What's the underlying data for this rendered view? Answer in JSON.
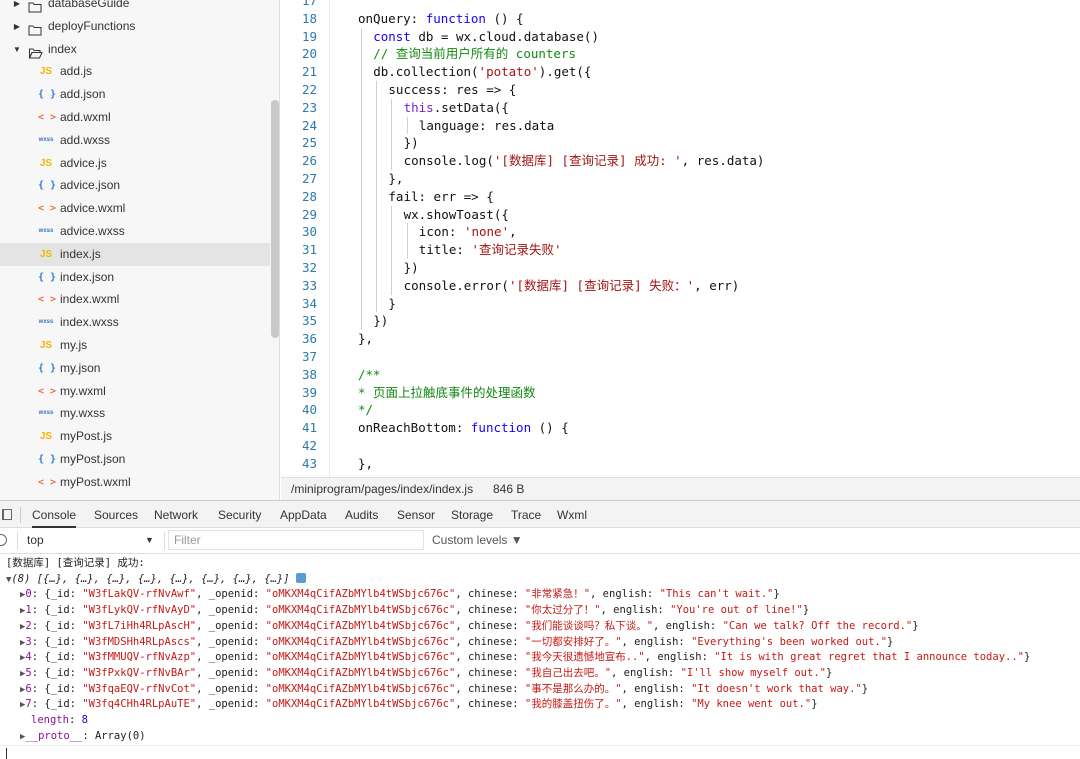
{
  "file_tree": {
    "items": [
      {
        "type": "folder",
        "name": "databaseGuide",
        "expanded": false
      },
      {
        "type": "folder",
        "name": "deployFunctions",
        "expanded": false
      },
      {
        "type": "folder",
        "name": "index",
        "expanded": true
      },
      {
        "type": "js",
        "name": "add.js"
      },
      {
        "type": "json",
        "name": "add.json"
      },
      {
        "type": "wxml",
        "name": "add.wxml"
      },
      {
        "type": "wxss",
        "name": "add.wxss"
      },
      {
        "type": "js",
        "name": "advice.js"
      },
      {
        "type": "json",
        "name": "advice.json"
      },
      {
        "type": "wxml",
        "name": "advice.wxml"
      },
      {
        "type": "wxss",
        "name": "advice.wxss"
      },
      {
        "type": "js",
        "name": "index.js",
        "selected": true
      },
      {
        "type": "json",
        "name": "index.json"
      },
      {
        "type": "wxml",
        "name": "index.wxml"
      },
      {
        "type": "wxss",
        "name": "index.wxss"
      },
      {
        "type": "js",
        "name": "my.js"
      },
      {
        "type": "json",
        "name": "my.json"
      },
      {
        "type": "wxml",
        "name": "my.wxml"
      },
      {
        "type": "wxss",
        "name": "my.wxss"
      },
      {
        "type": "js",
        "name": "myPost.js"
      },
      {
        "type": "json",
        "name": "myPost.json"
      },
      {
        "type": "wxml",
        "name": "myPost.wxml"
      }
    ],
    "icon_glyphs": {
      "js": "JS",
      "json": "{ }",
      "wxml": "< >",
      "wxss": "wxss"
    }
  },
  "editor": {
    "lines": [
      {
        "n": "17",
        "indent": 0,
        "tokens": []
      },
      {
        "n": "18",
        "indent": 0,
        "tokens": [
          [
            "p",
            "onQuery: "
          ],
          [
            "k",
            "function"
          ],
          [
            "p",
            " () {"
          ]
        ]
      },
      {
        "n": "19",
        "indent": 1,
        "tokens": [
          [
            "k",
            "const"
          ],
          [
            "p",
            " db = wx.cloud.database()"
          ]
        ]
      },
      {
        "n": "20",
        "indent": 1,
        "tokens": [
          [
            "c",
            "// 查询当前用户所有的 counters"
          ]
        ]
      },
      {
        "n": "21",
        "indent": 1,
        "tokens": [
          [
            "p",
            "db.collection("
          ],
          [
            "s",
            "'potato'"
          ],
          [
            "p",
            ").get({"
          ]
        ]
      },
      {
        "n": "22",
        "indent": 2,
        "tokens": [
          [
            "p",
            "success: res => {"
          ]
        ]
      },
      {
        "n": "23",
        "indent": 3,
        "tokens": [
          [
            "kp",
            "this"
          ],
          [
            "p",
            ".setData({"
          ]
        ]
      },
      {
        "n": "24",
        "indent": 4,
        "tokens": [
          [
            "p",
            "language: res.data"
          ]
        ]
      },
      {
        "n": "25",
        "indent": 3,
        "tokens": [
          [
            "p",
            "})"
          ]
        ]
      },
      {
        "n": "26",
        "indent": 3,
        "tokens": [
          [
            "p",
            "console.log("
          ],
          [
            "s",
            "'[数据库] [查询记录] 成功: '"
          ],
          [
            "p",
            ", res.data)"
          ]
        ]
      },
      {
        "n": "27",
        "indent": 2,
        "tokens": [
          [
            "p",
            "},"
          ]
        ]
      },
      {
        "n": "28",
        "indent": 2,
        "tokens": [
          [
            "p",
            "fail: err => {"
          ]
        ]
      },
      {
        "n": "29",
        "indent": 3,
        "tokens": [
          [
            "p",
            "wx.showToast({"
          ]
        ]
      },
      {
        "n": "30",
        "indent": 4,
        "tokens": [
          [
            "p",
            "icon: "
          ],
          [
            "s",
            "'none'"
          ],
          [
            "p",
            ","
          ]
        ]
      },
      {
        "n": "31",
        "indent": 4,
        "tokens": [
          [
            "p",
            "title: "
          ],
          [
            "s",
            "'查询记录失败'"
          ]
        ]
      },
      {
        "n": "32",
        "indent": 3,
        "tokens": [
          [
            "p",
            "})"
          ]
        ]
      },
      {
        "n": "33",
        "indent": 3,
        "tokens": [
          [
            "p",
            "console.error("
          ],
          [
            "s",
            "'[数据库] [查询记录] 失败：'"
          ],
          [
            "p",
            ", err)"
          ]
        ]
      },
      {
        "n": "34",
        "indent": 2,
        "tokens": [
          [
            "p",
            "}"
          ]
        ]
      },
      {
        "n": "35",
        "indent": 1,
        "tokens": [
          [
            "p",
            "})"
          ]
        ]
      },
      {
        "n": "36",
        "indent": 0,
        "tokens": [
          [
            "p",
            "},"
          ]
        ]
      },
      {
        "n": "37",
        "indent": 0,
        "tokens": []
      },
      {
        "n": "38",
        "indent": 0,
        "tokens": [
          [
            "c",
            "/**"
          ]
        ]
      },
      {
        "n": "39",
        "indent": 0,
        "tokens": [
          [
            "c",
            "* 页面上拉触底事件的处理函数"
          ]
        ]
      },
      {
        "n": "40",
        "indent": 0,
        "tokens": [
          [
            "c",
            "*/"
          ]
        ]
      },
      {
        "n": "41",
        "indent": 0,
        "tokens": [
          [
            "p",
            "onReachBottom: "
          ],
          [
            "k",
            "function"
          ],
          [
            "p",
            " () {"
          ]
        ]
      },
      {
        "n": "42",
        "indent": 0,
        "tokens": []
      },
      {
        "n": "43",
        "indent": 0,
        "tokens": [
          [
            "p",
            "},"
          ]
        ]
      }
    ]
  },
  "status_bar": {
    "path": "/miniprogram/pages/index/index.js",
    "size": "846 B"
  },
  "devtools": {
    "tabs": [
      "Console",
      "Sources",
      "Network",
      "Security",
      "AppData",
      "Audits",
      "Sensor",
      "Storage",
      "Trace",
      "Wxml"
    ],
    "active_tab": "Console",
    "context": "top",
    "filter_placeholder": "Filter",
    "levels": "Custom levels ▼"
  },
  "console": {
    "header": "[数据库] [查询记录] 成功:",
    "array_summary": "(8) [{…}, {…}, {…}, {…}, {…}, {…}, {…}, {…}]",
    "openid": "oMKXM4qCifAZbMYlb4tWSbjc676c",
    "entries": [
      {
        "index": "0",
        "_id": "W3fLakQV-rfNvAwf",
        "chinese": "非常紧急！",
        "english": "This can't wait."
      },
      {
        "index": "1",
        "_id": "W3fLykQV-rfNvAyD",
        "chinese": "你太过分了！",
        "english": "You're out of line!"
      },
      {
        "index": "2",
        "_id": "W3fL7iHh4RLpAscH",
        "chinese": "我们能谈谈吗？私下谈。",
        "english": "Can we talk? Off the record."
      },
      {
        "index": "3",
        "_id": "W3fMDSHh4RLpAscs",
        "chinese": "一切都安排好了。",
        "english": "Everything's been worked out."
      },
      {
        "index": "4",
        "_id": "W3fMMUQV-rfNvAzp",
        "chinese": "我今天很遗憾地宣布..",
        "english": "It is with great regret that I announce today.."
      },
      {
        "index": "5",
        "_id": "W3fPxkQV-rfNvBAr",
        "chinese": "我自己出去吧。",
        "english": "I'll show myself out."
      },
      {
        "index": "6",
        "_id": "W3fqaEQV-rfNvCot",
        "chinese": "事不是那么办的。",
        "english": "It doesn't work that way."
      },
      {
        "index": "7",
        "_id": "W3fq4CHh4RLpAuTE",
        "chinese": "我的膝盖扭伤了。",
        "english": "My knee went out."
      }
    ],
    "length_label": "length",
    "length_value": "8",
    "proto_label": "__proto__",
    "proto_value": "Array(0)"
  },
  "colors": {
    "string": "#c41a16",
    "key": "#881391",
    "number": "#1c00cf",
    "keyword": "#1a00ff"
  }
}
